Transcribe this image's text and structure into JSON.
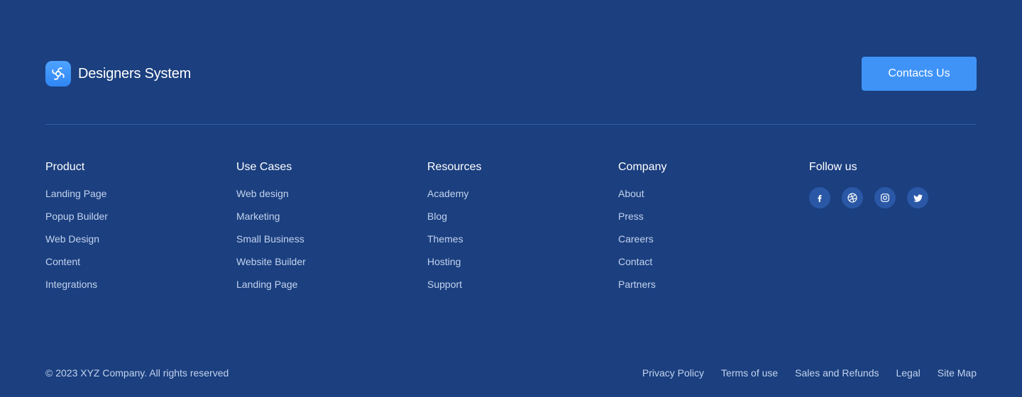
{
  "brand": {
    "name": "Designers System",
    "logo_icon": "pinwheel-icon",
    "accent": "#3f93f7"
  },
  "cta": {
    "label": "Contacts Us"
  },
  "columns": [
    {
      "title": "Product",
      "links": [
        "Landing Page",
        "Popup Builder",
        "Web Design",
        "Content",
        "Integrations"
      ]
    },
    {
      "title": "Use Cases",
      "links": [
        "Web design",
        "Marketing",
        "Small Business",
        "Website Builder",
        "Landing Page"
      ]
    },
    {
      "title": "Resources",
      "links": [
        "Academy",
        "Blog",
        "Themes",
        "Hosting",
        "Support"
      ]
    },
    {
      "title": "Company",
      "links": [
        "About",
        "Press",
        "Careers",
        "Contact",
        "Partners"
      ]
    }
  ],
  "follow": {
    "title": "Follow us",
    "icons": [
      "facebook-icon",
      "dribbble-icon",
      "instagram-icon",
      "twitter-icon"
    ]
  },
  "bottom": {
    "copyright": "© 2023 XYZ Company. All rights reserved",
    "links": [
      "Privacy Policy",
      "Terms of use",
      "Sales and Refunds",
      "Legal",
      "Site Map"
    ]
  },
  "colors": {
    "background": "#1b3f7f",
    "link": "#c3d3ee",
    "social_bg": "#2a58a7",
    "divider": "#2f5ca1"
  }
}
